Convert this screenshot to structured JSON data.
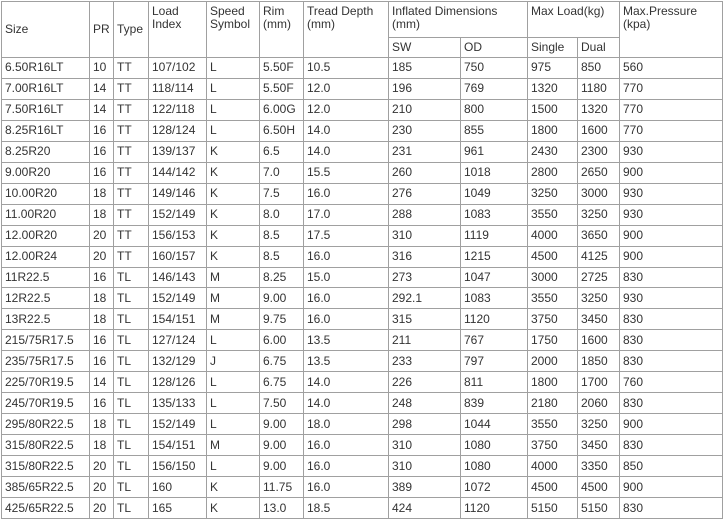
{
  "headers": {
    "size": "Size",
    "pr": "PR",
    "type": "Type",
    "load_index": "Load Index",
    "speed_symbol": "Speed Symbol",
    "rim": "Rim (mm)",
    "tread_depth": "Tread Depth (mm)",
    "inflated_dimensions": "Inflated Dimensions (mm)",
    "sw": "SW",
    "od": "OD",
    "max_load": "Max Load(kg)",
    "single": "Single",
    "dual": "Dual",
    "max_pressure": "Max.Pressure (kpa)"
  },
  "rows": [
    {
      "size": "6.50R16LT",
      "pr": "10",
      "type": "TT",
      "load_index": "107/102",
      "speed": "L",
      "rim": "5.50F",
      "tread": "10.5",
      "sw": "185",
      "od": "750",
      "single": "975",
      "dual": "850",
      "pressure": "560"
    },
    {
      "size": "7.00R16LT",
      "pr": "14",
      "type": "TT",
      "load_index": "118/114",
      "speed": "L",
      "rim": "5.50F",
      "tread": "12.0",
      "sw": "196",
      "od": "769",
      "single": "1320",
      "dual": "1180",
      "pressure": "770"
    },
    {
      "size": "7.50R16LT",
      "pr": "14",
      "type": "TT",
      "load_index": "122/118",
      "speed": "L",
      "rim": "6.00G",
      "tread": "12.0",
      "sw": "210",
      "od": "800",
      "single": "1500",
      "dual": "1320",
      "pressure": "770"
    },
    {
      "size": "8.25R16LT",
      "pr": "16",
      "type": "TT",
      "load_index": "128/124",
      "speed": "L",
      "rim": "6.50H",
      "tread": "14.0",
      "sw": "230",
      "od": "855",
      "single": "1800",
      "dual": "1600",
      "pressure": "770"
    },
    {
      "size": "8.25R20",
      "pr": "16",
      "type": "TT",
      "load_index": "139/137",
      "speed": "K",
      "rim": "6.5",
      "tread": "14.0",
      "sw": "231",
      "od": "961",
      "single": "2430",
      "dual": "2300",
      "pressure": "930"
    },
    {
      "size": "9.00R20",
      "pr": "16",
      "type": "TT",
      "load_index": "144/142",
      "speed": "K",
      "rim": "7.0",
      "tread": "15.5",
      "sw": "260",
      "od": "1018",
      "single": "2800",
      "dual": "2650",
      "pressure": "900"
    },
    {
      "size": "10.00R20",
      "pr": "18",
      "type": "TT",
      "load_index": "149/146",
      "speed": "K",
      "rim": "7.5",
      "tread": "16.0",
      "sw": "276",
      "od": "1049",
      "single": "3250",
      "dual": "3000",
      "pressure": "930"
    },
    {
      "size": "11.00R20",
      "pr": "18",
      "type": "TT",
      "load_index": "152/149",
      "speed": "K",
      "rim": "8.0",
      "tread": "17.0",
      "sw": "288",
      "od": "1083",
      "single": "3550",
      "dual": "3250",
      "pressure": "930"
    },
    {
      "size": "12.00R20",
      "pr": "20",
      "type": "TT",
      "load_index": "156/153",
      "speed": "K",
      "rim": "8.5",
      "tread": "17.5",
      "sw": "310",
      "od": "1119",
      "single": "4000",
      "dual": "3650",
      "pressure": "900"
    },
    {
      "size": "12.00R24",
      "pr": "20",
      "type": "TT",
      "load_index": "160/157",
      "speed": "K",
      "rim": "8.5",
      "tread": "16.0",
      "sw": "316",
      "od": "1215",
      "single": "4500",
      "dual": "4125",
      "pressure": "900"
    },
    {
      "size": "11R22.5",
      "pr": "16",
      "type": "TL",
      "load_index": "146/143",
      "speed": "M",
      "rim": "8.25",
      "tread": "15.0",
      "sw": "273",
      "od": "1047",
      "single": "3000",
      "dual": "2725",
      "pressure": "830"
    },
    {
      "size": "12R22.5",
      "pr": "18",
      "type": "TL",
      "load_index": "152/149",
      "speed": "M",
      "rim": "9.00",
      "tread": "16.0",
      "sw": "292.1",
      "od": "1083",
      "single": "3550",
      "dual": "3250",
      "pressure": "930"
    },
    {
      "size": "13R22.5",
      "pr": "18",
      "type": "TL",
      "load_index": "154/151",
      "speed": "M",
      "rim": "9.75",
      "tread": "16.0",
      "sw": "315",
      "od": "1120",
      "single": "3750",
      "dual": "3450",
      "pressure": "830"
    },
    {
      "size": "215/75R17.5",
      "pr": "16",
      "type": "TL",
      "load_index": "127/124",
      "speed": "L",
      "rim": "6.00",
      "tread": "13.5",
      "sw": "211",
      "od": "767",
      "single": "1750",
      "dual": "1600",
      "pressure": "830"
    },
    {
      "size": "235/75R17.5",
      "pr": "16",
      "type": "TL",
      "load_index": "132/129",
      "speed": "J",
      "rim": "6.75",
      "tread": "13.5",
      "sw": "233",
      "od": "797",
      "single": "2000",
      "dual": "1850",
      "pressure": "830"
    },
    {
      "size": "225/70R19.5",
      "pr": "14",
      "type": "TL",
      "load_index": "128/126",
      "speed": "L",
      "rim": "6.75",
      "tread": "14.0",
      "sw": "226",
      "od": "811",
      "single": "1800",
      "dual": "1700",
      "pressure": "760"
    },
    {
      "size": "245/70R19.5",
      "pr": "16",
      "type": "TL",
      "load_index": "135/133",
      "speed": "L",
      "rim": "7.50",
      "tread": "14.0",
      "sw": "248",
      "od": "839",
      "single": "2180",
      "dual": "2060",
      "pressure": "830"
    },
    {
      "size": "295/80R22.5",
      "pr": "18",
      "type": "TL",
      "load_index": "152/149",
      "speed": "L",
      "rim": "9.00",
      "tread": "18.0",
      "sw": "298",
      "od": "1044",
      "single": "3550",
      "dual": "3250",
      "pressure": "900"
    },
    {
      "size": "315/80R22.5",
      "pr": "18",
      "type": "TL",
      "load_index": "154/151",
      "speed": "M",
      "rim": "9.00",
      "tread": "16.0",
      "sw": "310",
      "od": "1080",
      "single": "3750",
      "dual": "3450",
      "pressure": "830"
    },
    {
      "size": "315/80R22.5",
      "pr": "20",
      "type": "TL",
      "load_index": "156/150",
      "speed": "L",
      "rim": "9.00",
      "tread": "16.0",
      "sw": "310",
      "od": "1080",
      "single": "4000",
      "dual": "3350",
      "pressure": "850"
    },
    {
      "size": "385/65R22.5",
      "pr": "20",
      "type": "TL",
      "load_index": "160",
      "speed": "K",
      "rim": "11.75",
      "tread": "16.0",
      "sw": "389",
      "od": "1072",
      "single": "4500",
      "dual": "4500",
      "pressure": "900"
    },
    {
      "size": "425/65R22.5",
      "pr": "20",
      "type": "TL",
      "load_index": "165",
      "speed": "K",
      "rim": "13.0",
      "tread": "18.5",
      "sw": "424",
      "od": "1120",
      "single": "5150",
      "dual": "5150",
      "pressure": "830"
    }
  ]
}
